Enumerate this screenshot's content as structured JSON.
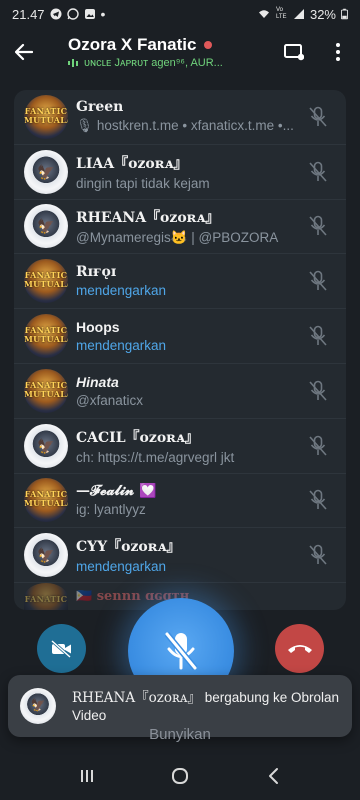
{
  "status_bar": {
    "time": "21.47",
    "battery": "32%",
    "network": "Vo LTE"
  },
  "header": {
    "title": "Ozora X Fanatic",
    "speaking_text": "ᴜɴᴄʟᴇ Jᴀᴘʀᴜᴛ agen⁹⁶, AUR..."
  },
  "participants": [
    {
      "name": "Green",
      "subtitle": "🎙 hostkren.t.me • xfanaticx.t.me •...",
      "subtitle_style": "grey",
      "avatar": "fanatic",
      "muted": true
    },
    {
      "name": "LIAA『ᴏᴢᴏʀᴀ』",
      "subtitle": "dingin tapi tidak kejam",
      "subtitle_style": "grey",
      "avatar": "ozora",
      "muted": true
    },
    {
      "name": "RHEANA『ᴏᴢᴏʀᴀ』",
      "subtitle": "@Mynameregis🐱 | @PBOZORA",
      "subtitle_style": "grey",
      "avatar": "ozora",
      "muted": true
    },
    {
      "name": "Rɪғǫɪ",
      "subtitle": "mendengarkan",
      "subtitle_style": "blue",
      "avatar": "fanatic",
      "muted": true
    },
    {
      "name": "Hoops",
      "subtitle": "mendengarkan",
      "subtitle_style": "blue",
      "avatar": "fanatic",
      "muted": true
    },
    {
      "name": "Hinata",
      "subtitle": "@xfanaticx",
      "subtitle_style": "grey",
      "avatar": "fanatic",
      "muted": true
    },
    {
      "name": "CACIL『ᴏᴢᴏʀᴀ』",
      "subtitle": "ch: https://t.me/agrvegrl jkt",
      "subtitle_style": "grey",
      "avatar": "ozora",
      "muted": true
    },
    {
      "name": "—𝓕𝓮𝓪𝓵𝓲𝓷 💟",
      "subtitle": "ig: lyantlyyz",
      "subtitle_style": "grey",
      "avatar": "fanatic",
      "muted": true
    },
    {
      "name": "CYY『ᴏᴢᴏʀᴀ』",
      "subtitle": "mendengarkan",
      "subtitle_style": "blue",
      "avatar": "ozora",
      "muted": true
    }
  ],
  "partial_row": {
    "name": "🇵🇭 sennn ɑɢɑᴛʜ"
  },
  "controls": {
    "main_label": "Bunyikan"
  },
  "toast": {
    "name": "RHEANA『ᴏᴢᴏʀᴀ』",
    "message": "bergabung ke Obrolan Video"
  },
  "colors": {
    "background": "#1b1f24",
    "list_bg": "#242a30",
    "accent_blue": "#4fa6e8",
    "speaking_green": "#70d37c",
    "end_call_red": "#c24745",
    "camera_blue": "#1f6e95",
    "recording_dot": "#e0595a"
  }
}
